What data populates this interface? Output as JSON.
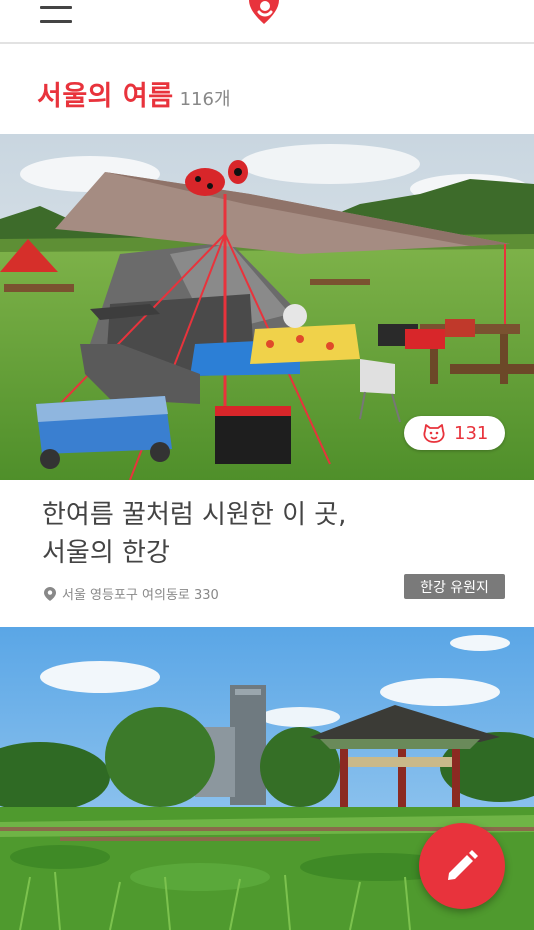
{
  "header": {
    "menu_icon": "hamburger-menu-icon",
    "logo_icon": "heart-logo-icon",
    "brand_color": "#e8333c"
  },
  "section": {
    "title": "서울의 여름",
    "count": "116개"
  },
  "cards": [
    {
      "likes": "131",
      "like_icon": "bear-face-icon",
      "title_line1": "한여름 꿀처럼 시원한 이 곳,",
      "title_line2": "서울의 한강",
      "location": "서울 영등포구 여의동로 330",
      "location_icon": "map-pin-icon",
      "tag": "한강 유원지"
    }
  ],
  "fab": {
    "icon": "pencil-icon"
  }
}
